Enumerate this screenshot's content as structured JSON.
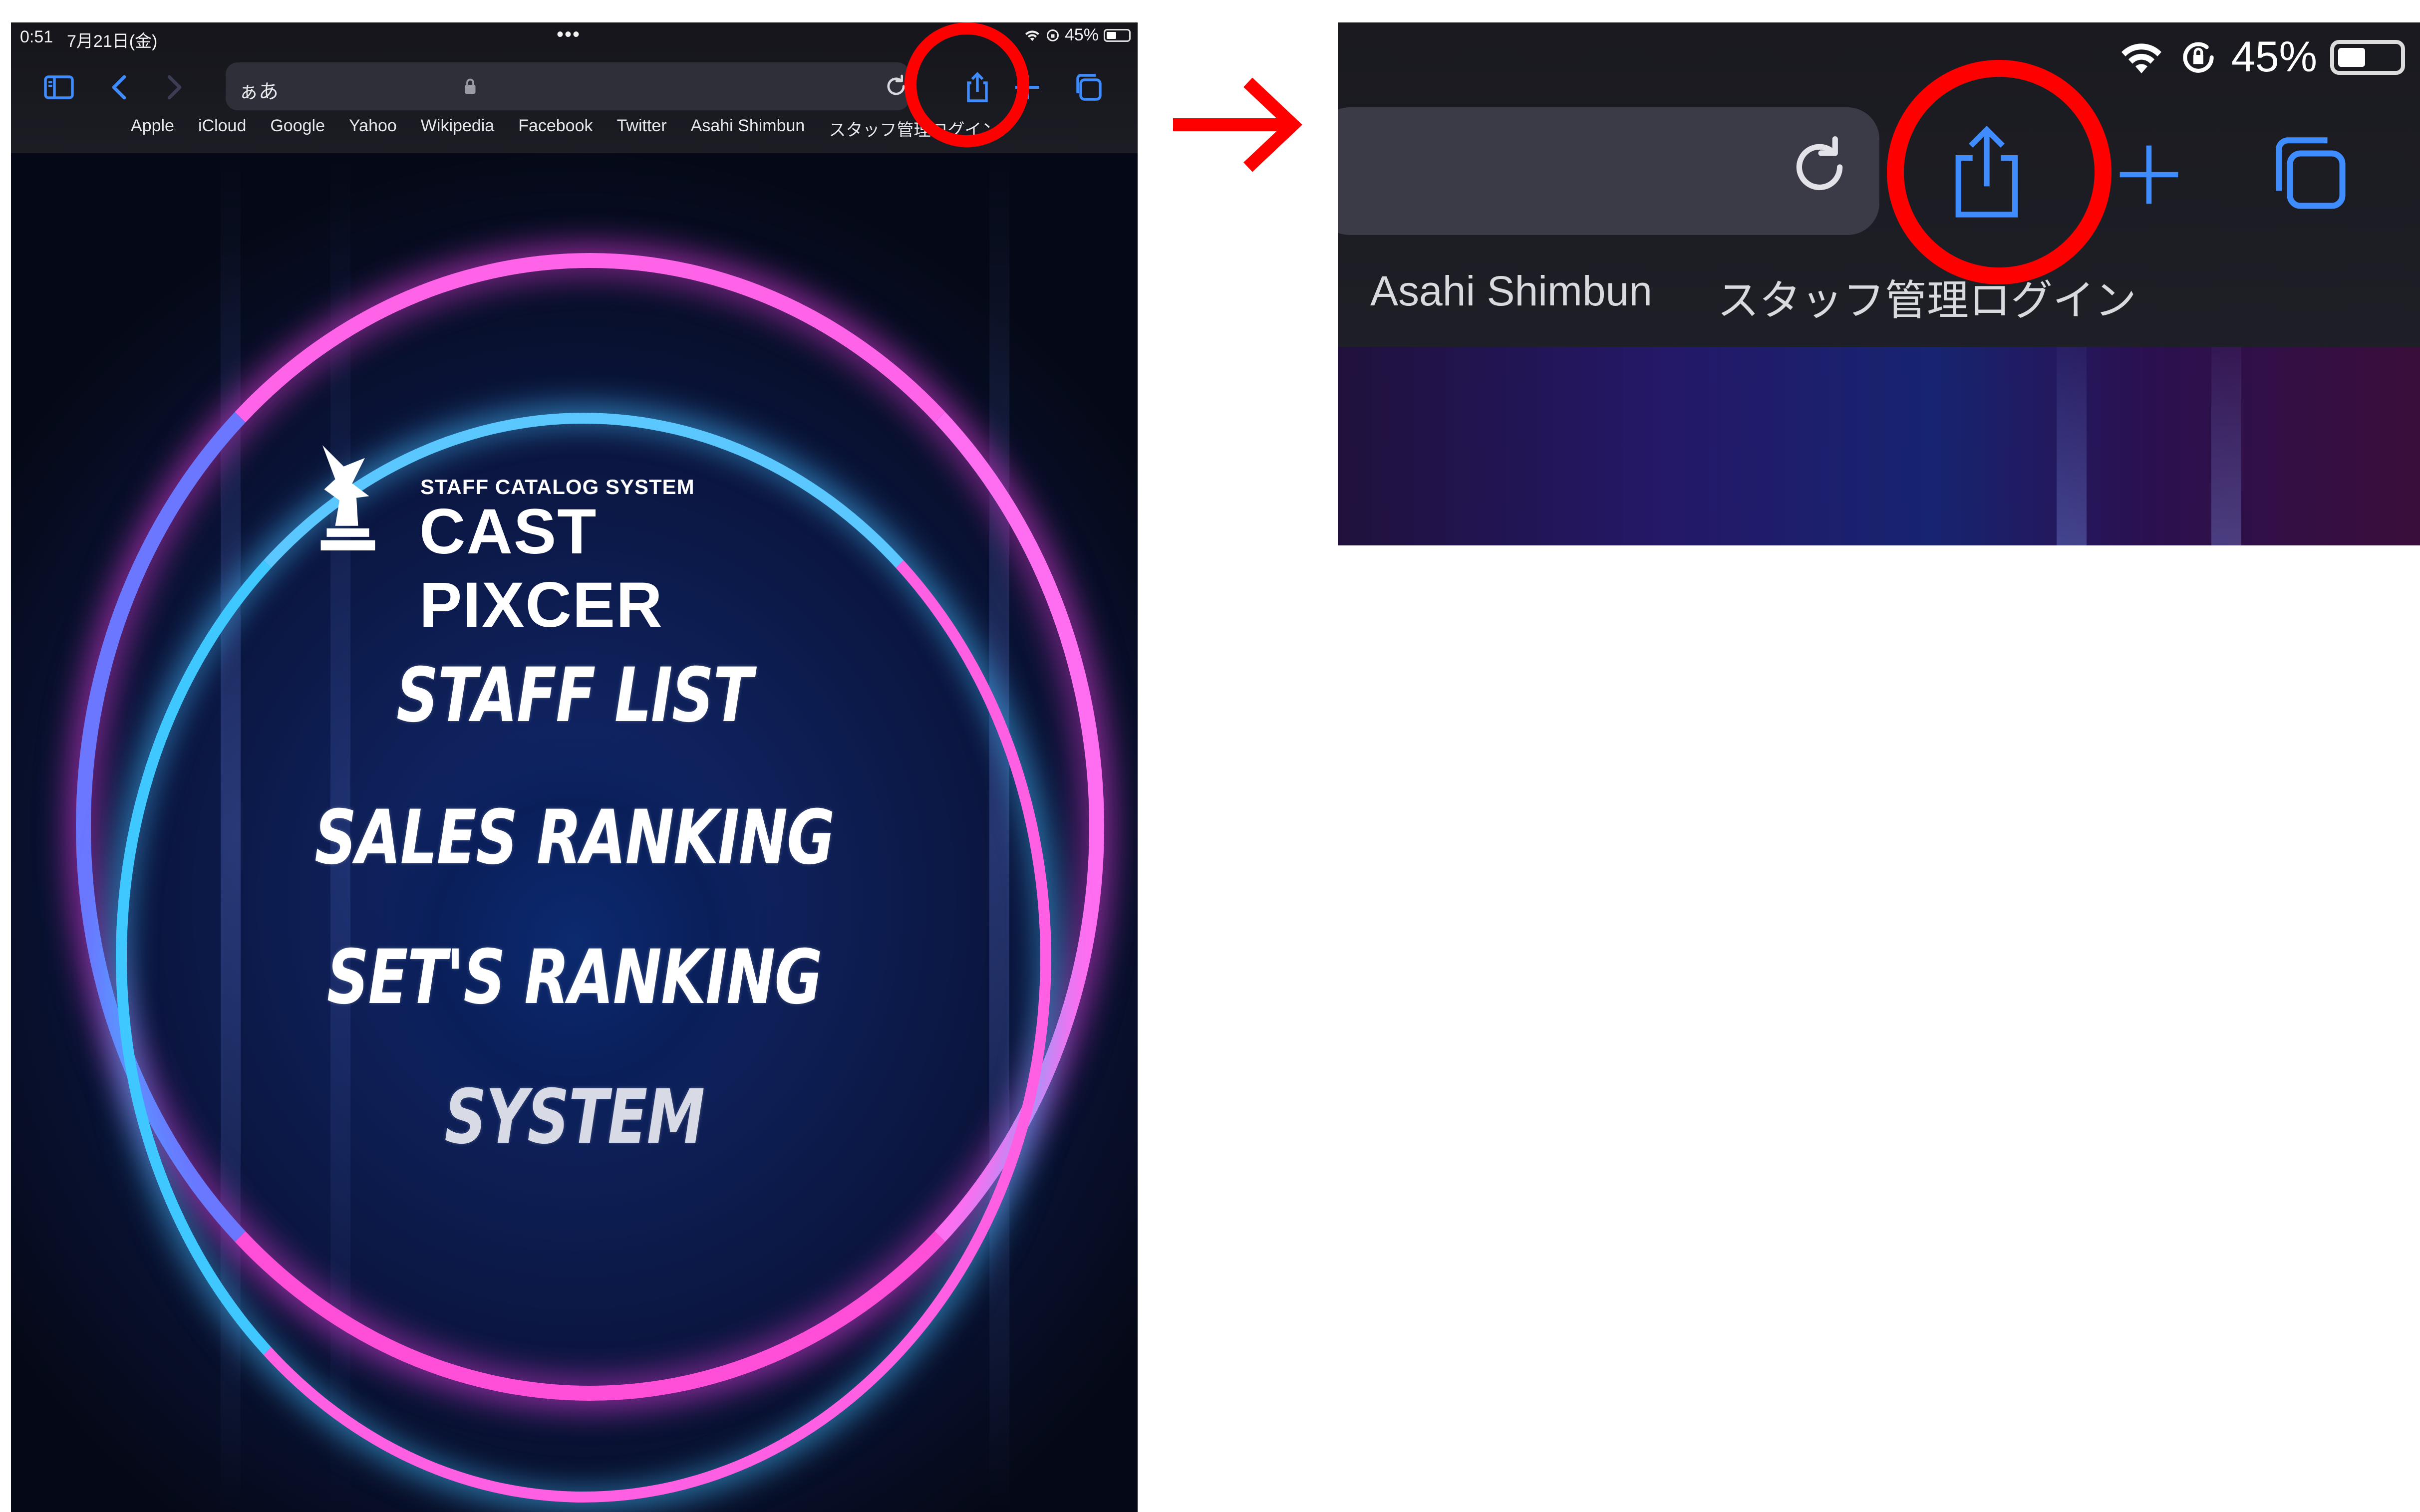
{
  "statusbar": {
    "time": "0:51",
    "date": "7月21日(金)",
    "battery": "45%",
    "battery_level": 0.45
  },
  "toolbar": {
    "address_text": "ぁあ"
  },
  "bookmarks": [
    "Apple",
    "iCloud",
    "Google",
    "Yahoo",
    "Wikipedia",
    "Facebook",
    "Twitter",
    "Asahi Shimbun",
    "スタッフ管理ログイン"
  ],
  "page": {
    "logo_subtitle": "STAFF CATALOG SYSTEM",
    "logo_title": "CAST PIXCER",
    "menu": [
      "STAFF LIST",
      "SALES RANKING",
      "SET'S RANKING",
      "SYSTEM"
    ]
  },
  "zoom": {
    "battery": "45%",
    "bookmarks": [
      "Asahi Shimbun",
      "スタッフ管理ログイン"
    ]
  },
  "colors": {
    "highlight": "#ff0000",
    "accent": "#3f8cff"
  },
  "icons": [
    "sidebar-icon",
    "back-icon",
    "forward-icon",
    "lock-icon",
    "reload-icon",
    "share-icon",
    "plus-icon",
    "tabs-icon",
    "wifi-icon",
    "orientation-lock-icon",
    "battery-icon",
    "arrow-right-icon"
  ]
}
